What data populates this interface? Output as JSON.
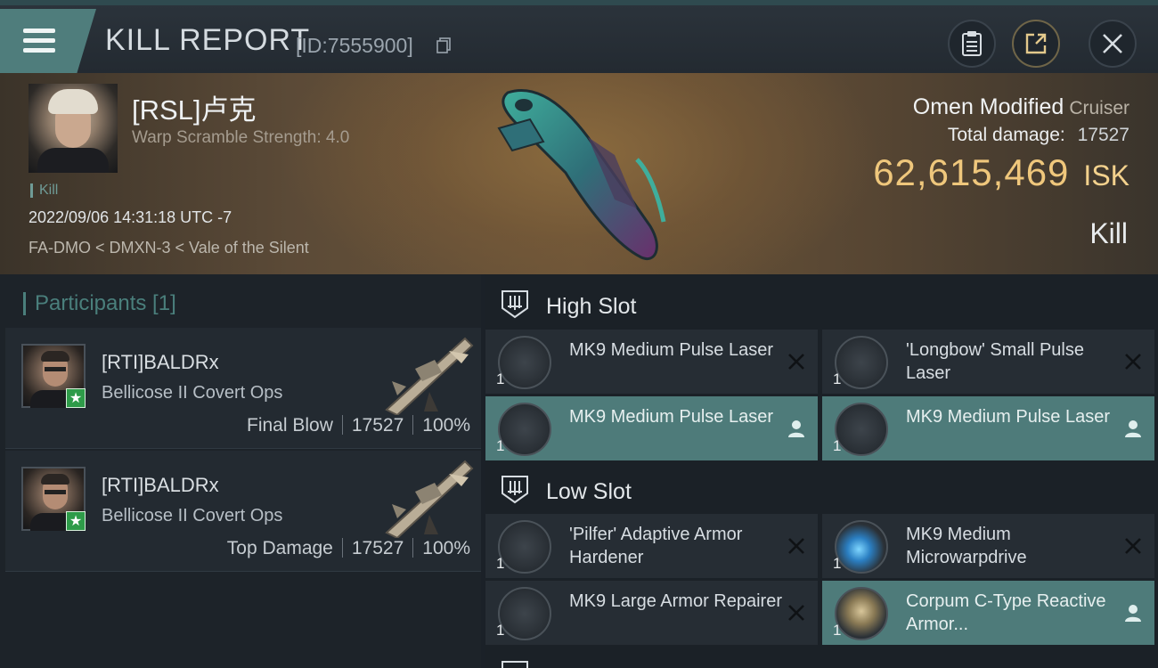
{
  "header": {
    "title": "KILL REPORT",
    "report_id": "[ID:7555900]"
  },
  "victim": {
    "name": "[RSL]卢克",
    "warp_scramble": "Warp Scramble Strength: 4.0",
    "tag": "Kill",
    "datetime": "2022/09/06 14:31:18 UTC -7",
    "location": "FA-DMO < DMXN-3 < Vale of the Silent",
    "ship_name": "Omen Modified",
    "ship_class": "Cruiser",
    "total_damage_label": "Total damage:",
    "total_damage": "17527",
    "isk_value": "62,615,469",
    "isk_unit": "ISK",
    "result": "Kill"
  },
  "participants": {
    "heading": "Participants [1]",
    "rows": [
      {
        "name": "[RTI]BALDRx",
        "ship": "Bellicose II Covert Ops",
        "role": "Final Blow",
        "damage": "17527",
        "percent": "100%"
      },
      {
        "name": "[RTI]BALDRx",
        "ship": "Bellicose II Covert Ops",
        "role": "Top Damage",
        "damage": "17527",
        "percent": "100%"
      }
    ]
  },
  "slots": {
    "high": {
      "title": "High Slot",
      "modules": [
        {
          "qty": "1",
          "name": "MK9 Medium Pulse Laser",
          "state": "destroyed"
        },
        {
          "qty": "1",
          "name": "'Longbow' Small Pulse Laser",
          "state": "destroyed"
        },
        {
          "qty": "1",
          "name": "MK9 Medium Pulse Laser",
          "state": "dropped"
        },
        {
          "qty": "1",
          "name": "MK9 Medium Pulse Laser",
          "state": "dropped"
        }
      ]
    },
    "low": {
      "title": "Low Slot",
      "modules": [
        {
          "qty": "1",
          "name": "'Pilfer' Adaptive Armor Hardener",
          "state": "destroyed"
        },
        {
          "qty": "1",
          "name": "MK9 Medium Microwarpdrive",
          "state": "destroyed"
        },
        {
          "qty": "1",
          "name": "MK9 Large Armor Repairer",
          "state": "destroyed"
        },
        {
          "qty": "1",
          "name": "Corpum C-Type Reactive Armor...",
          "state": "dropped"
        }
      ]
    }
  },
  "colors": {
    "accent_teal": "#4e7b7a",
    "isk_gold": "#efc77c",
    "star_green": "#2e9b49"
  }
}
